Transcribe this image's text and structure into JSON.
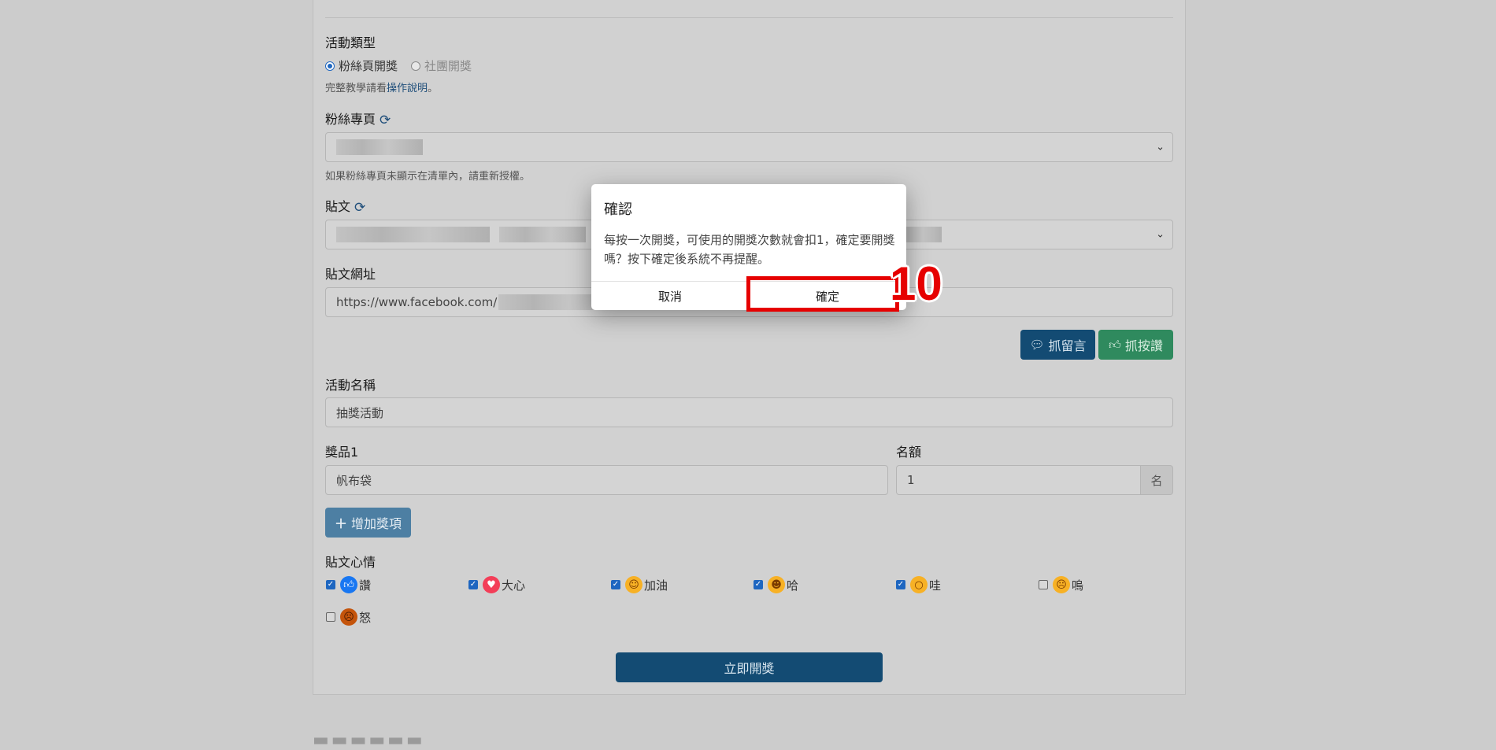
{
  "form": {
    "activity_type_label": "活動類型",
    "activity_types": [
      {
        "label": "粉絲頁開獎",
        "selected": true
      },
      {
        "label": "社團開獎",
        "selected": false
      }
    ],
    "tutorial_prefix": "完整教學請看",
    "tutorial_link": "操作說明",
    "tutorial_suffix": "。",
    "fanpage_label": "粉絲專頁",
    "fanpage_hint": "如果粉絲專頁未顯示在清單內，請重新授權。",
    "post_label": "貼文",
    "post_url_label": "貼文網址",
    "post_url_value": "https://www.facebook.com/",
    "fetch_comments_label": "抓留言",
    "fetch_likes_label": "抓按讚",
    "event_name_label": "活動名稱",
    "event_name_value": "抽獎活動",
    "prize_label": "獎品1",
    "prize_value": "帆布袋",
    "quota_label": "名額",
    "quota_value": "1",
    "quota_unit": "名",
    "add_prize_label": "增加獎項",
    "reactions_label": "貼文心情",
    "reactions": [
      {
        "label": "讚",
        "checked": true,
        "icon": "like-icon",
        "color": "#1877f2"
      },
      {
        "label": "大心",
        "checked": true,
        "icon": "love-icon",
        "color": "#f33e58"
      },
      {
        "label": "加油",
        "checked": true,
        "icon": "care-icon",
        "color": "#f7b125"
      },
      {
        "label": "哈",
        "checked": true,
        "icon": "haha-icon",
        "color": "#f7b125"
      },
      {
        "label": "哇",
        "checked": true,
        "icon": "wow-icon",
        "color": "#f7b125"
      },
      {
        "label": "嗚",
        "checked": false,
        "icon": "sad-icon",
        "color": "#f7b125"
      },
      {
        "label": "怒",
        "checked": false,
        "icon": "angry-icon",
        "color": "#e9710f"
      }
    ],
    "submit_label": "立即開獎"
  },
  "modal": {
    "title": "確認",
    "body": "每按一次開獎，可使用的開獎次數就會扣1，確定要開獎嗎？按下確定後系統不再提醒。",
    "cancel_label": "取消",
    "confirm_label": "確定"
  },
  "annotation": {
    "step_number": "10",
    "color": "#e60000"
  }
}
